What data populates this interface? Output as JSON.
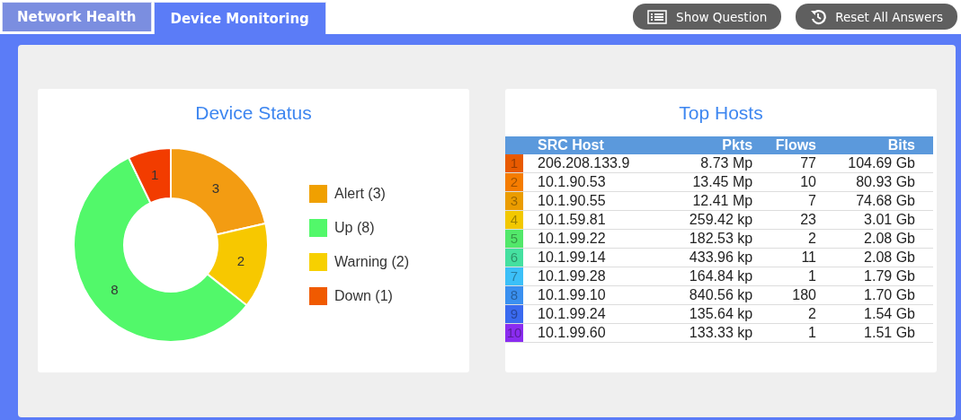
{
  "tabs": [
    {
      "label": "Network Health",
      "selected": false
    },
    {
      "label": "Device Monitoring",
      "selected": true
    }
  ],
  "toolbar": [
    {
      "label": "Show Question",
      "kind": "question"
    },
    {
      "label": "Reset All Answers",
      "kind": "reset"
    }
  ],
  "device_status": {
    "title": "Device Status",
    "chart_data": {
      "type": "donut",
      "values": [
        3,
        2,
        8,
        1
      ],
      "colors": [
        "#f39c12",
        "#f7c800",
        "#52f86a",
        "#f23c00"
      ],
      "data_labels": true
    },
    "legend": [
      {
        "label": "Alert (3)",
        "color": "#f0a000"
      },
      {
        "label": "Up (8)",
        "color": "#52f86a"
      },
      {
        "label": "Warning (2)",
        "color": "#f7d000"
      },
      {
        "label": "Down (1)",
        "color": "#f05a00"
      }
    ]
  },
  "top_hosts": {
    "title": "Top Hosts",
    "columns": [
      "SRC Host",
      "Pkts",
      "Flows",
      "Bits"
    ],
    "rows": [
      {
        "rank": "1",
        "color": "#e85a00",
        "host": "206.208.133.9",
        "pkts": "8.73 Mp",
        "flows": "77",
        "bits": "104.69 Gb"
      },
      {
        "rank": "2",
        "color": "#f57c00",
        "host": "10.1.90.53",
        "pkts": "13.45 Mp",
        "flows": "10",
        "bits": "80.93 Gb"
      },
      {
        "rank": "3",
        "color": "#eb9c00",
        "host": "10.1.90.55",
        "pkts": "12.41 Mp",
        "flows": "7",
        "bits": "74.68 Gb"
      },
      {
        "rank": "4",
        "color": "#f2c800",
        "host": "10.1.59.81",
        "pkts": "259.42 kp",
        "flows": "23",
        "bits": "3.01 Gb"
      },
      {
        "rank": "5",
        "color": "#52e86a",
        "host": "10.1.99.22",
        "pkts": "182.53 kp",
        "flows": "2",
        "bits": "2.08 Gb"
      },
      {
        "rank": "6",
        "color": "#45e0a0",
        "host": "10.1.99.14",
        "pkts": "433.96 kp",
        "flows": "11",
        "bits": "2.08 Gb"
      },
      {
        "rank": "7",
        "color": "#3cc0f8",
        "host": "10.1.99.28",
        "pkts": "164.84 kp",
        "flows": "1",
        "bits": "1.79 Gb"
      },
      {
        "rank": "8",
        "color": "#3a90f0",
        "host": "10.1.99.10",
        "pkts": "840.56 kp",
        "flows": "180",
        "bits": "1.70 Gb"
      },
      {
        "rank": "9",
        "color": "#3a6af0",
        "host": "10.1.99.24",
        "pkts": "135.64 kp",
        "flows": "2",
        "bits": "1.54 Gb"
      },
      {
        "rank": "10",
        "color": "#8a2cf0",
        "host": "10.1.99.60",
        "pkts": "133.33 kp",
        "flows": "1",
        "bits": "1.51 Gb"
      }
    ]
  }
}
